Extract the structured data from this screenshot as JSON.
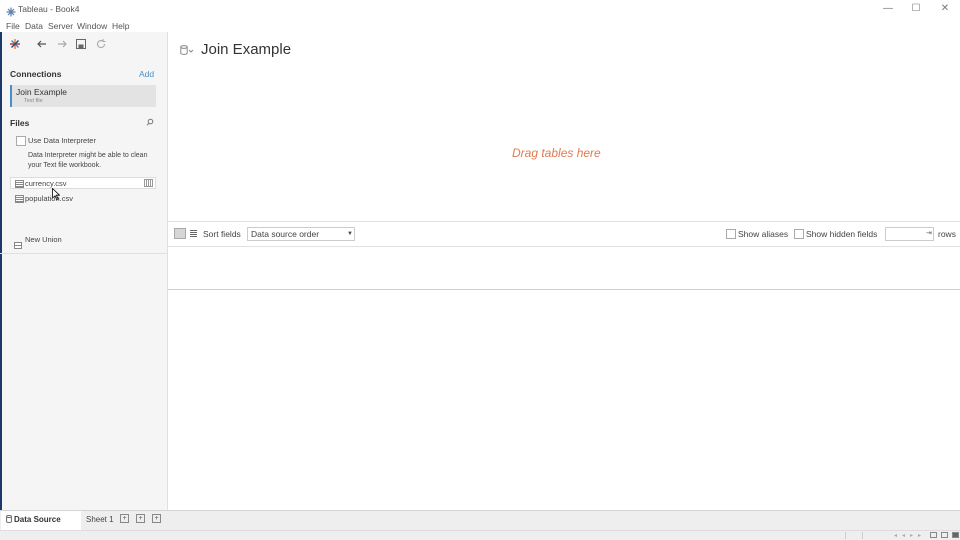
{
  "window": {
    "title": "Tableau - Book4",
    "min_symbol": "—",
    "max_symbol": "☐",
    "close_symbol": "✕"
  },
  "menubar": {
    "items": [
      "File",
      "Data",
      "Server",
      "Window",
      "Help"
    ]
  },
  "toolbar_icons": [
    "tableau-logo-icon",
    "back-icon",
    "forward-icon",
    "save-icon",
    "refresh-icon"
  ],
  "left_panel": {
    "connections_title": "Connections",
    "add_label": "Add",
    "connection": {
      "name": "Join Example",
      "type": "Text file"
    },
    "files_title": "Files",
    "interpreter_label": "Use Data Interpreter",
    "interpreter_desc": "Data Interpreter might be able to clean your Text file workbook.",
    "files": [
      "currency.csv",
      "population.csv"
    ],
    "new_union_label": "New Union"
  },
  "canvas": {
    "datasource_title": "Join Example",
    "drag_hint": "Drag tables here"
  },
  "grid_toolbar": {
    "sort_label": "Sort fields",
    "sort_value": "Data source order",
    "show_aliases_label": "Show aliases",
    "show_hidden_label": "Show hidden fields",
    "rows_label": "rows",
    "rows_value": ""
  },
  "bottom_tabs": {
    "data_source_label": "Data Source",
    "sheet_label": "Sheet 1"
  },
  "colors": {
    "accent": "#4a90c8",
    "drag_hint": "#e07b4f",
    "left_edge": "#1b3a6b"
  }
}
